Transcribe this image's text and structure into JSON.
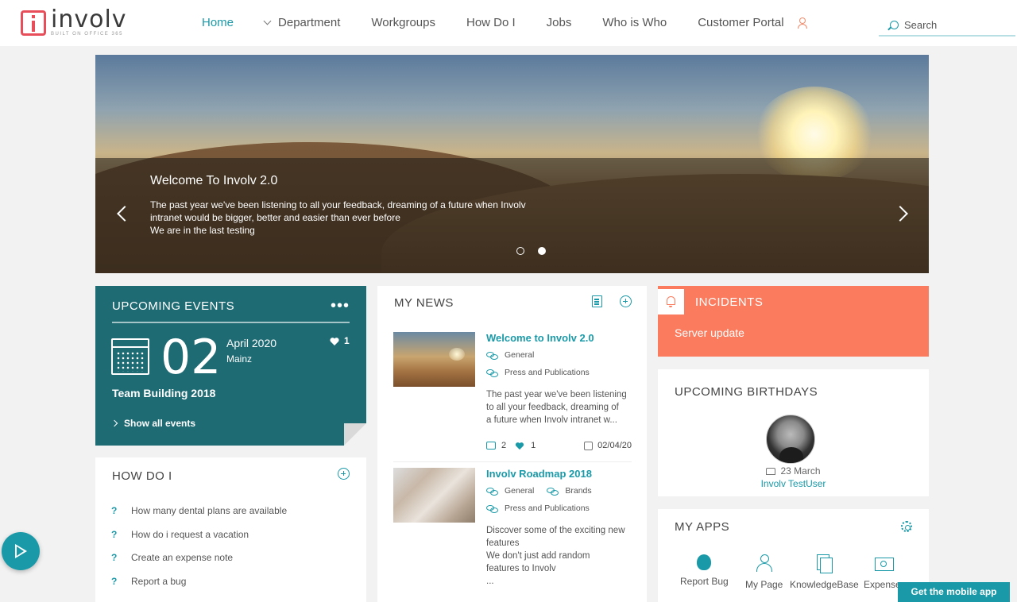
{
  "header": {
    "logo_word": "involv",
    "logo_sub": "BUILT ON OFFICE 365",
    "nav": [
      "Home",
      "Department",
      "Workgroups",
      "How Do I",
      "Jobs",
      "Who is Who",
      "Customer Portal"
    ],
    "search_placeholder": "Search"
  },
  "hero": {
    "title": "Welcome To Involv 2.0",
    "lines": [
      "The past year we've been listening to all your feedback, dreaming of a future when Involv",
      "intranet would be bigger, better and easier than ever before",
      "We are in the last testing"
    ],
    "active_slide": 2,
    "slide_count": 2
  },
  "events": {
    "title": "UPCOMING EVENTS",
    "more": "•••",
    "day": "02",
    "month": "April 2020",
    "city": "Mainz",
    "likes": "1",
    "name": "Team Building 2018",
    "show_all": "Show all events"
  },
  "howdo": {
    "title": "HOW DO I",
    "items": [
      "How many dental plans are available",
      "How do i request a vacation",
      "Create an expense note",
      "Report a bug"
    ],
    "marker": "?"
  },
  "news": {
    "title": "MY NEWS",
    "items": [
      {
        "title": "Welcome to Involv 2.0",
        "tags": [
          "General",
          "Press and Publications"
        ],
        "desc": [
          "The past year we've been listening",
          "to all your feedback, dreaming of",
          "a future when Involv intranet w..."
        ],
        "comments": "2",
        "likes": "1",
        "date": "02/04/20"
      },
      {
        "title": "Involv Roadmap 2018",
        "tags": [
          "General",
          "Brands",
          "Press and Publications"
        ],
        "desc": [
          "Discover some of the exciting new",
          "features",
          "We don't just add random",
          "features to Involv",
          "..."
        ]
      }
    ]
  },
  "incidents": {
    "title": "INCIDENTS",
    "item": "Server update"
  },
  "birthdays": {
    "title": "UPCOMING BIRTHDAYS",
    "date": "23 March",
    "name": "Involv TestUser"
  },
  "apps": {
    "title": "MY APPS",
    "items": [
      "Report Bug",
      "My Page",
      "KnowledgeBase",
      "Expenses"
    ]
  },
  "mobile_button": "Get the mobile app",
  "colors": {
    "accent": "#1a9aa8",
    "events_bg": "#1f6b74",
    "incidents_bg": "#fa7b5d",
    "logo": "#e84e5a"
  }
}
